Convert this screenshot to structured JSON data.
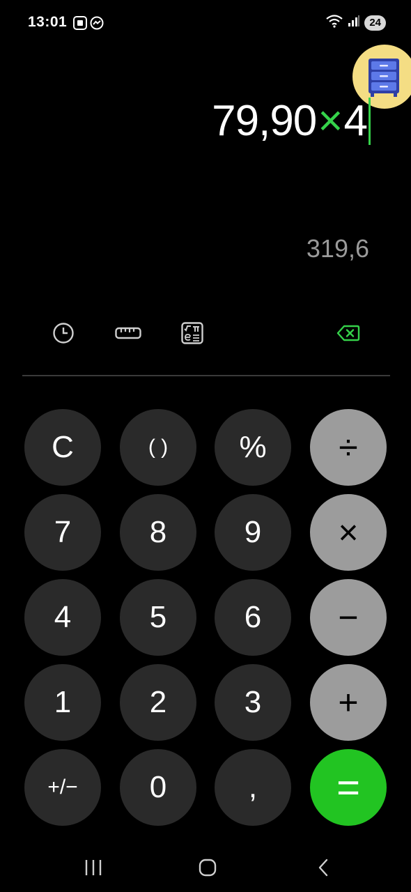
{
  "status_bar": {
    "time": "13:01",
    "battery": "24",
    "icons": [
      "photo-notification-icon",
      "messenger-icon",
      "wifi-icon",
      "signal-icon"
    ]
  },
  "floating_bubble": {
    "icon": "drawer-cabinet-icon",
    "color": "#f4dd84"
  },
  "display": {
    "expression_left": "79,90",
    "expression_operator": "×",
    "expression_right": "4",
    "result": "319,6",
    "accent_color": "#35d24a"
  },
  "toolbar": {
    "icons": [
      "history-icon",
      "unit-converter-icon",
      "scientific-mode-icon",
      "backspace-icon"
    ]
  },
  "keypad": {
    "clear": "C",
    "parentheses": "( )",
    "percent": "%",
    "divide": "÷",
    "seven": "7",
    "eight": "8",
    "nine": "9",
    "multiply": "×",
    "four": "4",
    "five": "5",
    "six": "6",
    "minus": "−",
    "one": "1",
    "two": "2",
    "three": "3",
    "plus": "+",
    "plus_minus": "+/−",
    "zero": "0",
    "decimal": ",",
    "equals": "=",
    "operator_color": "#9c9c9c",
    "equals_color": "#22c422"
  },
  "nav_bar": {
    "icons": [
      "recent-apps-icon",
      "home-icon",
      "back-icon"
    ]
  }
}
